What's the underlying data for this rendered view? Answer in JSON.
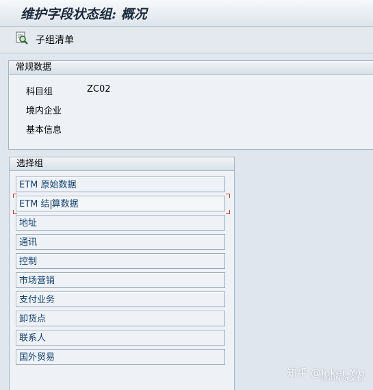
{
  "window": {
    "title": "维护字段状态组: 概况"
  },
  "toolbar": {
    "subgroup_list_label": "子组清单",
    "subgroup_list_icon": "search-doc-icon"
  },
  "general": {
    "header": "常规数据",
    "account_group_label": "科目组",
    "account_group_value": "ZC02",
    "line2": "境内企业",
    "line3": "基本信息"
  },
  "groups": {
    "header": "选择组",
    "items": [
      {
        "label": "ETM 原始数据"
      },
      {
        "label_a": "ETM 结",
        "label_b": "算数据"
      },
      {
        "label": "地址"
      },
      {
        "label": "通讯"
      },
      {
        "label": "控制"
      },
      {
        "label": "市场营销"
      },
      {
        "label": "支付业务"
      },
      {
        "label": "卸货点"
      },
      {
        "label": "联系人"
      },
      {
        "label": "国外贸易"
      }
    ]
  },
  "watermark": {
    "text": "知乎 @Joker Yin",
    "sub": "CSDN @文松"
  },
  "colors": {
    "accent": "#13406f",
    "focus": "#c0392b",
    "background": "#dfe6ee"
  }
}
